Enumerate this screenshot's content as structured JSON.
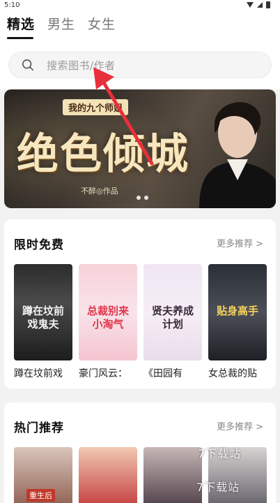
{
  "status_bar": {
    "time": "5:10"
  },
  "tabs": [
    {
      "label": "精选",
      "active": true
    },
    {
      "label": "男生",
      "active": false
    },
    {
      "label": "女生",
      "active": false
    }
  ],
  "search": {
    "placeholder": "搜索图书/作者"
  },
  "banner": {
    "subtitle": "我的九个师姐",
    "title": "绝色倾城",
    "author": "不醉◎作品",
    "page_count": 2
  },
  "limited_free": {
    "title": "限时免费",
    "more": "更多推荐 >",
    "books": [
      {
        "title": "蹲在坟前戏",
        "cover_text": "蹲在坟前戏鬼夫"
      },
      {
        "title": "豪门风云：",
        "cover_text": "总裁别来小淘气"
      },
      {
        "title": "《田园有",
        "cover_text": "贤夫养成计划"
      },
      {
        "title": "女总裁的贴",
        "cover_text": "贴身高手"
      }
    ]
  },
  "hot": {
    "title": "热门推荐",
    "more": "更多推荐 >",
    "books": [
      {
        "cover_text": "重生后"
      },
      {
        "cover_text": ""
      },
      {
        "cover_text": ""
      },
      {
        "cover_text": ""
      }
    ]
  },
  "watermark": [
    "7下载站",
    "7下载站"
  ],
  "colors": {
    "accent": "#111111",
    "arrow": "#e8303a",
    "background": "#f2f2f2"
  }
}
